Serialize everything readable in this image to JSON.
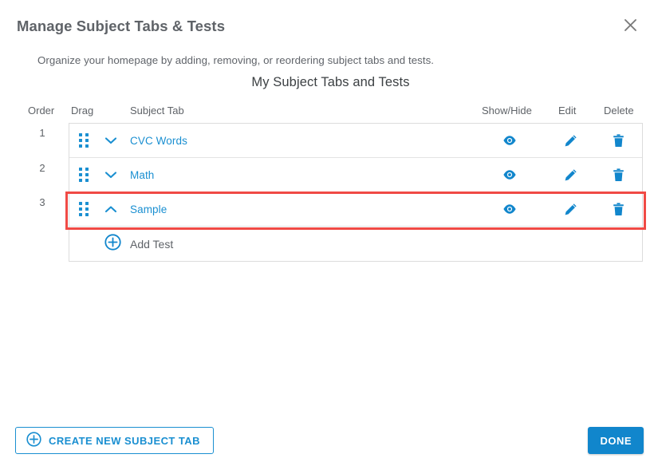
{
  "dialog": {
    "title": "Manage Subject Tabs & Tests",
    "close_icon": "close-icon",
    "subtitle": "Organize your homepage by adding, removing, or reordering subject tabs and tests.",
    "section_heading": "My Subject Tabs and Tests"
  },
  "table": {
    "headers": {
      "order": "Order",
      "drag": "Drag",
      "subject_tab": "Subject Tab",
      "show_hide": "Show/Hide",
      "edit": "Edit",
      "delete": "Delete"
    },
    "rows": [
      {
        "order": "1",
        "label": "CVC Words",
        "chevron": "chevron-down-icon",
        "expanded": false,
        "drag_icon": "drag-handle-icon",
        "show_hide_icon": "eye-icon",
        "edit_icon": "pencil-icon",
        "delete_icon": "trash-icon",
        "highlighted": false
      },
      {
        "order": "2",
        "label": "Math",
        "chevron": "chevron-down-icon",
        "expanded": false,
        "drag_icon": "drag-handle-icon",
        "show_hide_icon": "eye-icon",
        "edit_icon": "pencil-icon",
        "delete_icon": "trash-icon",
        "highlighted": false
      },
      {
        "order": "3",
        "label": "Sample",
        "chevron": "chevron-up-icon",
        "expanded": true,
        "drag_icon": "drag-handle-icon",
        "show_hide_icon": "eye-icon",
        "edit_icon": "pencil-icon",
        "delete_icon": "trash-icon",
        "highlighted": true
      }
    ],
    "add_test": {
      "label": "Add Test",
      "icon": "plus-circle-icon"
    }
  },
  "footer": {
    "create_tab_label": "CREATE NEW SUBJECT TAB",
    "create_tab_icon": "plus-circle-icon",
    "done_label": "DONE"
  },
  "colors": {
    "accent_blue": "#1a8fd1",
    "primary_button": "#1186cc",
    "annotation_red": "#f04a45",
    "text_gray": "#5f6368",
    "border_gray": "#dcdcdc"
  }
}
